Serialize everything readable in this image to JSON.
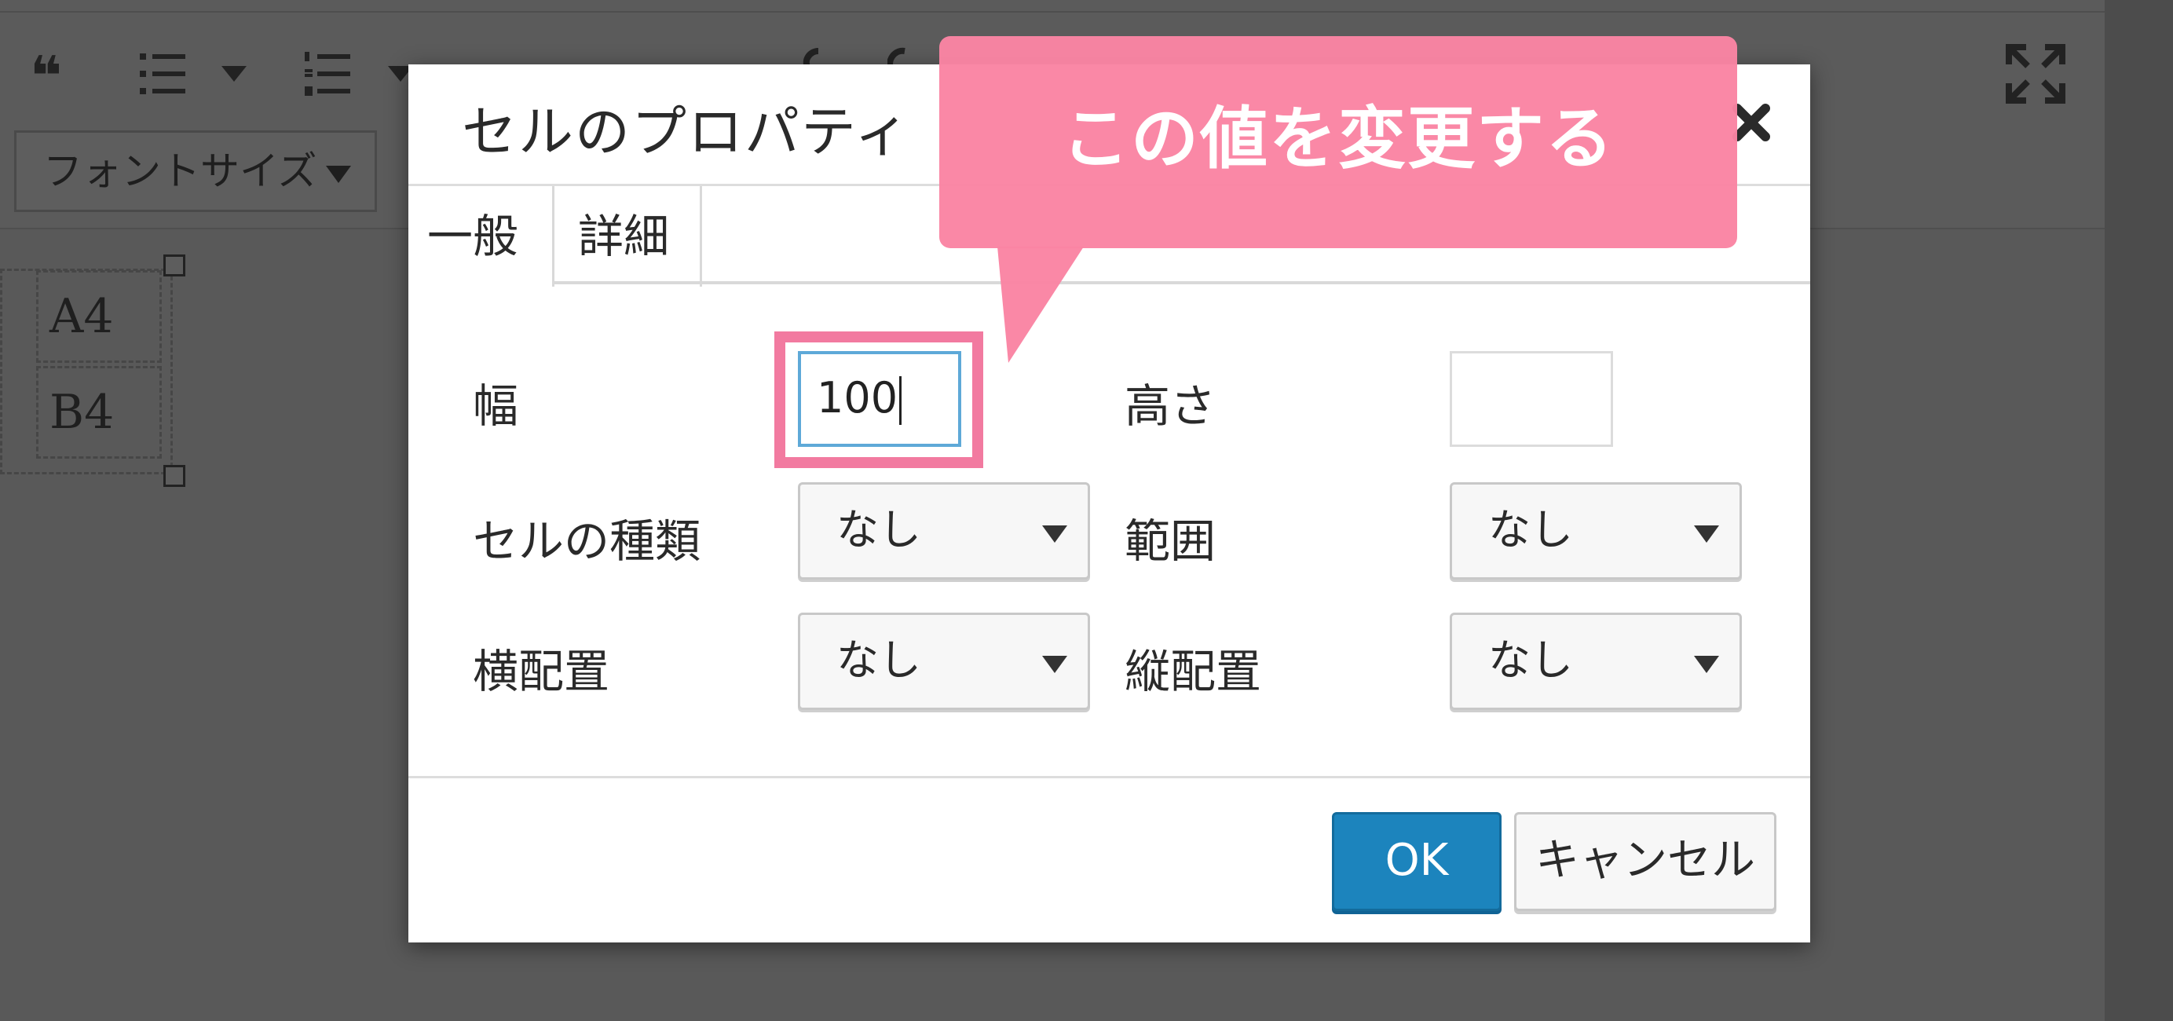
{
  "editor": {
    "font_size_select": "フォントサイズ",
    "table_cells": [
      "A4",
      "B4"
    ],
    "toolbar_icons": [
      "blockquote-icon",
      "bullet-list-icon",
      "numbered-list-icon",
      "align-left-icon",
      "align-center-icon",
      "align-right-icon",
      "link-icon",
      "unlink-icon",
      "table-icon",
      "fullscreen-icon"
    ]
  },
  "dialog": {
    "title": "セルのプロパティ",
    "tabs": [
      {
        "label": "一般",
        "active": true
      },
      {
        "label": "詳細",
        "active": false
      }
    ],
    "fields": {
      "width": {
        "label": "幅",
        "value": "100"
      },
      "height": {
        "label": "高さ",
        "value": ""
      },
      "cell_type": {
        "label": "セルの種類",
        "value": "なし"
      },
      "scope": {
        "label": "範囲",
        "value": "なし"
      },
      "h_align": {
        "label": "横配置",
        "value": "なし"
      },
      "v_align": {
        "label": "縦配置",
        "value": "なし"
      }
    },
    "buttons": {
      "ok": "OK",
      "cancel": "キャンセル"
    }
  },
  "annotation": {
    "callout_text": "この値を変更する",
    "highlight_color": "#f27aa0",
    "callout_color": "#fa84a3"
  },
  "colors": {
    "primary_button": "#1c84bd",
    "input_focus_border": "#5ea9d8",
    "overlay_background": "#595959"
  }
}
